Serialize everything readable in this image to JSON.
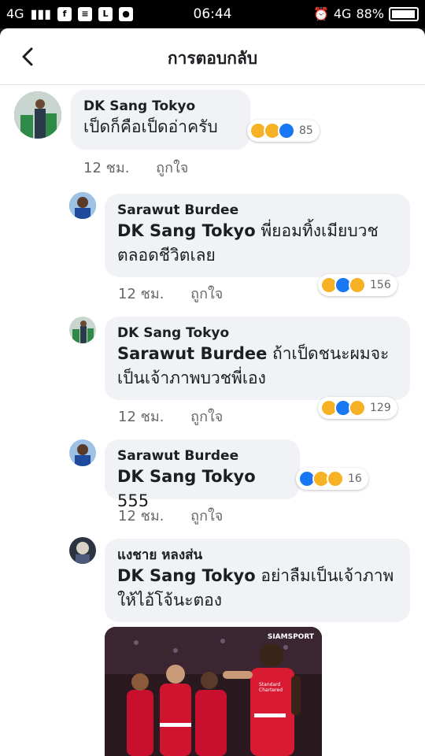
{
  "status_bar": {
    "network": "4G",
    "time": "06:44",
    "network_right": "4G",
    "battery": "88%"
  },
  "header": {
    "title": "การตอบกลับ"
  },
  "comments": [
    {
      "name": "DK Sang Tokyo",
      "mention": "",
      "text": "เป็ดก็คือเป็ดอ่าครับ",
      "text2": "",
      "time": "12 ชม.",
      "like": "ถูกใจ",
      "reaction_count": "85"
    },
    {
      "name": "Sarawut Burdee",
      "mention": "DK Sang Tokyo",
      "text": " พี่ยอมทิ้งเมียบวช",
      "text2": "ตลอดชีวิตเลย",
      "time": "12 ชม.",
      "like": "ถูกใจ",
      "reaction_count": "156"
    },
    {
      "name": "DK Sang Tokyo",
      "mention": "Sarawut Burdee",
      "text": " ถ้าเป็ดชนะผมจะ",
      "text2": "เป็นเจ้าภาพบวชพี่เอง",
      "time": "12 ชม.",
      "like": "ถูกใจ",
      "reaction_count": "129"
    },
    {
      "name": "Sarawut Burdee",
      "mention": "DK Sang Tokyo",
      "text": " 555",
      "text2": "",
      "time": "12 ชม.",
      "like": "ถูกใจ",
      "reaction_count": "16"
    },
    {
      "name": "แงชาย หลงส่น",
      "mention": "DK Sang Tokyo",
      "text": " อย่าลืมเป็นเจ้าภาพ",
      "text2": "ให้ไอ้โจ้นะตอง",
      "time": "",
      "like": "",
      "reaction_count": ""
    }
  ],
  "photo": {
    "watermark": "SIAMSPORT",
    "sponsor": "Standard Chartered"
  }
}
